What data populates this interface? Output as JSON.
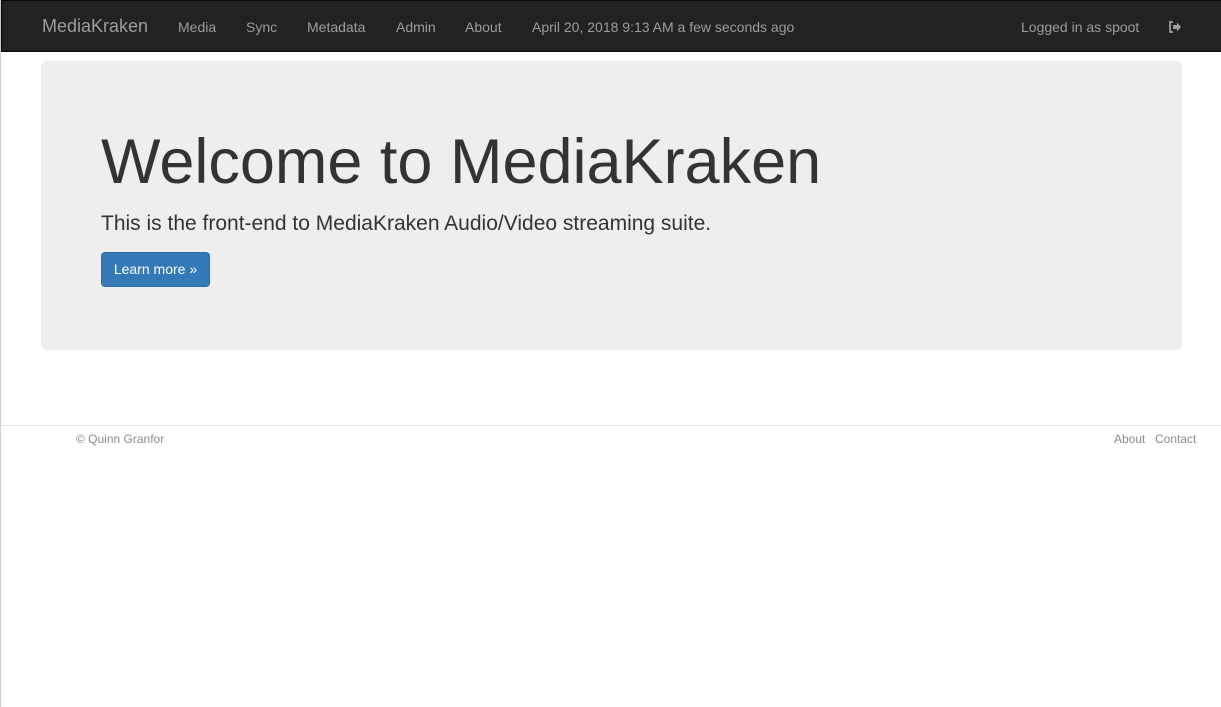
{
  "navbar": {
    "brand": "MediaKraken",
    "links": [
      {
        "label": "Media"
      },
      {
        "label": "Sync"
      },
      {
        "label": "Metadata"
      },
      {
        "label": "Admin"
      },
      {
        "label": "About"
      }
    ],
    "timestamp": "April 20, 2018 9:13 AM a few seconds ago",
    "user_text": "Logged in as spoot",
    "logout_icon": "sign-out-icon"
  },
  "jumbotron": {
    "title": "Welcome to MediaKraken",
    "lead": "This is the front-end to MediaKraken Audio/Video streaming suite.",
    "button_label": "Learn more »"
  },
  "footer": {
    "copyright": "© Quinn Granfor",
    "links": [
      {
        "label": "About"
      },
      {
        "label": "Contact"
      }
    ]
  },
  "colors": {
    "navbar_bg": "#222222",
    "nav_text": "#9d9d9d",
    "jumbotron_bg": "#eeeeee",
    "primary": "#337ab7"
  }
}
